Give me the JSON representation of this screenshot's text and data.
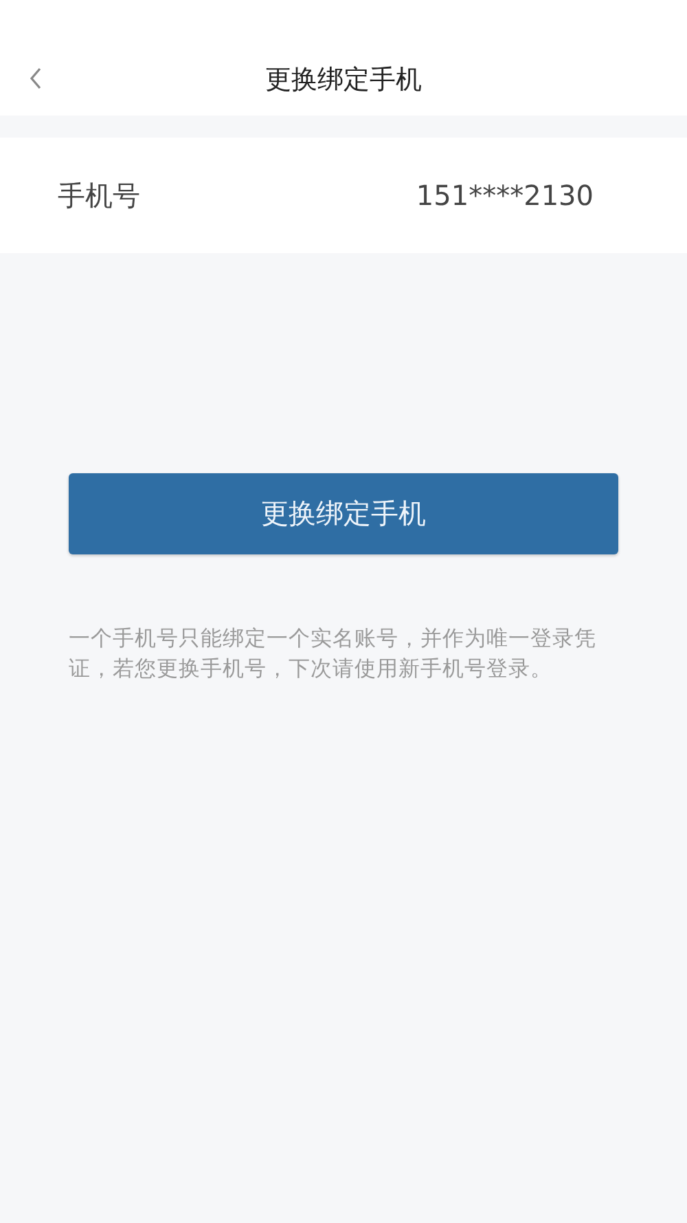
{
  "header": {
    "title": "更换绑定手机"
  },
  "phone_row": {
    "label": "手机号",
    "value": "151****2130"
  },
  "button": {
    "label": "更换绑定手机"
  },
  "note": "一个手机号只能绑定一个实名账号，并作为唯一登录凭证，若您更换手机号，下次请使用新手机号登录。"
}
